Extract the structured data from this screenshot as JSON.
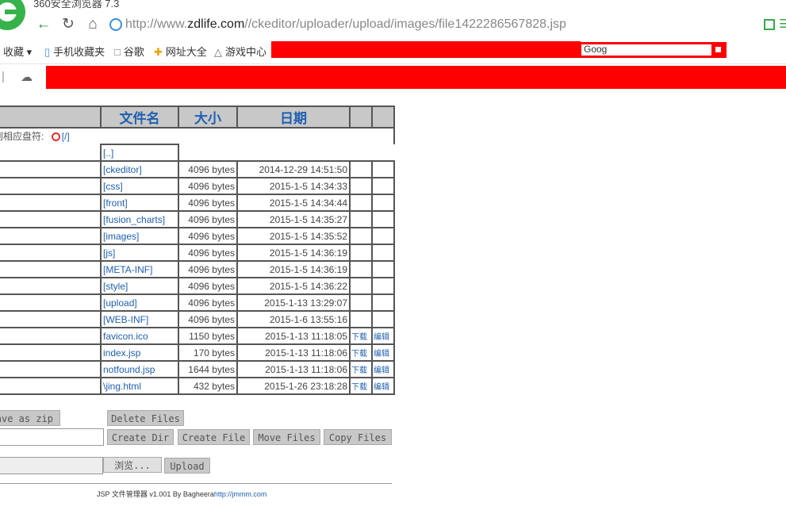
{
  "browser": {
    "title": "360安全浏览器 7.3",
    "url_prefix": "http://www.",
    "url_host": "zdlife.com",
    "url_path": "//ckeditor/uploader/upload/images/file1422286567828.jsp",
    "bookmarks": {
      "favorites": "收藏",
      "mobile": "手机收藏夹",
      "google": "谷歌",
      "hao": "网址大全",
      "games": "游戏中心",
      "partial_search": "Goog"
    }
  },
  "file_table": {
    "headers": {
      "name": "文件名",
      "size": "大小",
      "date": "日期"
    },
    "drive_label": "切换到相应盘符:",
    "drive_link": "[/]",
    "parent_link": "[..]",
    "rows": [
      {
        "name": "[ckeditor]",
        "size": "4096 bytes",
        "date": "2014-12-29 14:51:50",
        "download": "",
        "edit": ""
      },
      {
        "name": "[css]",
        "size": "4096 bytes",
        "date": "2015-1-5 14:34:33",
        "download": "",
        "edit": ""
      },
      {
        "name": "[front]",
        "size": "4096 bytes",
        "date": "2015-1-5 14:34:44",
        "download": "",
        "edit": ""
      },
      {
        "name": "[fusion_charts]",
        "size": "4096 bytes",
        "date": "2015-1-5 14:35:27",
        "download": "",
        "edit": ""
      },
      {
        "name": "[images]",
        "size": "4096 bytes",
        "date": "2015-1-5 14:35:52",
        "download": "",
        "edit": ""
      },
      {
        "name": "[js]",
        "size": "4096 bytes",
        "date": "2015-1-5 14:36:19",
        "download": "",
        "edit": ""
      },
      {
        "name": "[META-INF]",
        "size": "4096 bytes",
        "date": "2015-1-5 14:36:19",
        "download": "",
        "edit": ""
      },
      {
        "name": "[style]",
        "size": "4096 bytes",
        "date": "2015-1-5 14:36:22",
        "download": "",
        "edit": ""
      },
      {
        "name": "[upload]",
        "size": "4096 bytes",
        "date": "2015-1-13 13:29:07",
        "download": "",
        "edit": ""
      },
      {
        "name": "[WEB-INF]",
        "size": "4096 bytes",
        "date": "2015-1-6 13:55:16",
        "download": "",
        "edit": ""
      },
      {
        "name": "favicon.ico",
        "size": "1150 bytes",
        "date": "2015-1-13 11:18:05",
        "download": "下载",
        "edit": "编辑"
      },
      {
        "name": "index.jsp",
        "size": "170 bytes",
        "date": "2015-1-13 11:18:06",
        "download": "下载",
        "edit": "编辑"
      },
      {
        "name": "notfound.jsp",
        "size": "1644 bytes",
        "date": "2015-1-13 11:18:06",
        "download": "下载",
        "edit": "编辑"
      },
      {
        "name": "\\jing.html",
        "size": "432 bytes",
        "date": "2015-1-26 23:18:28",
        "download": "下载",
        "edit": "编辑"
      }
    ]
  },
  "actions": {
    "save_zip": "Save as zip",
    "delete_files": "Delete Files",
    "create_dir": "Create Dir",
    "create_file": "Create File",
    "move_files": "Move Files",
    "copy_files": "Copy Files",
    "browse": "浏览...",
    "upload": "Upload"
  },
  "footer": {
    "text": "JSP 文件管理器 v1.001 By Bagheera",
    "link": "http://jmmm.com"
  },
  "colors": {
    "redaction": "#ff0000",
    "link": "#1f5fb0",
    "header_bg": "#c8c8c8"
  }
}
